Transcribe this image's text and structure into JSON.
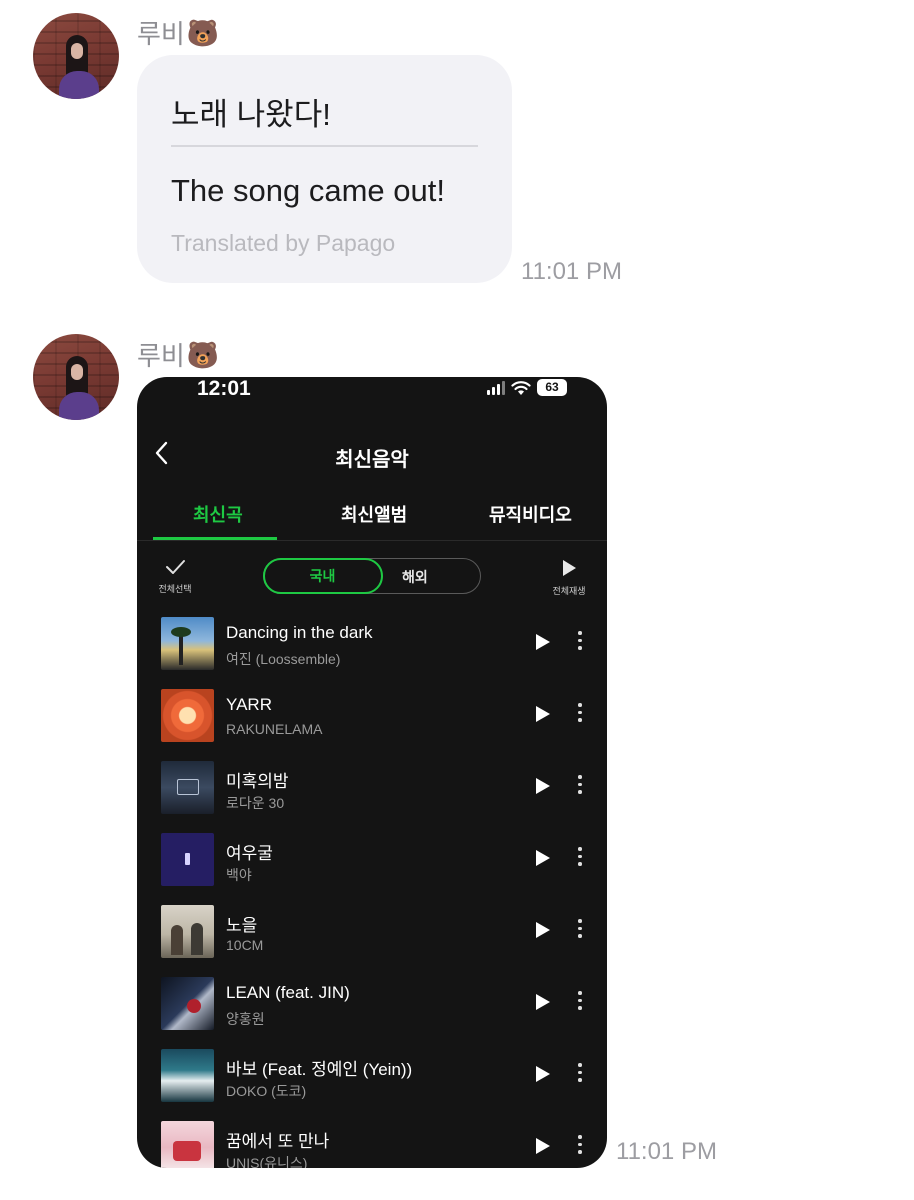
{
  "messages": [
    {
      "sender": "루비",
      "sender_emoji": "🐻",
      "original_text": "노래 나왔다!",
      "translated_text": "The song came out!",
      "translation_credit": "Translated by Papago",
      "time": "11:01 PM"
    },
    {
      "sender": "루비",
      "sender_emoji": "🐻",
      "time": "11:01 PM"
    }
  ],
  "screenshot": {
    "status_time": "12:01",
    "battery": "63",
    "title": "최신음악",
    "tabs": [
      "최신곡",
      "최신앨범",
      "뮤직비디오"
    ],
    "select_all_label": "전체선택",
    "toggle": {
      "active": "국내",
      "inactive": "해외"
    },
    "play_all_label": "전체재생",
    "accent_color": "#1ec943",
    "songs": [
      {
        "title": "Dancing in the dark",
        "artist": "여진 (Loossemble)"
      },
      {
        "title": "YARR",
        "artist": "RAKUNELAMA"
      },
      {
        "title": "미혹의밤",
        "artist": "로다운 30"
      },
      {
        "title": "여우굴",
        "artist": "백야"
      },
      {
        "title": "노을",
        "artist": "10CM"
      },
      {
        "title": "LEAN (feat. JIN)",
        "artist": "양홍원"
      },
      {
        "title": "바보 (Feat. 정예인 (Yein))",
        "artist": "DOKO (도코)"
      },
      {
        "title": "꿈에서 또 만나",
        "artist": "UNIS(유니스)"
      }
    ]
  }
}
